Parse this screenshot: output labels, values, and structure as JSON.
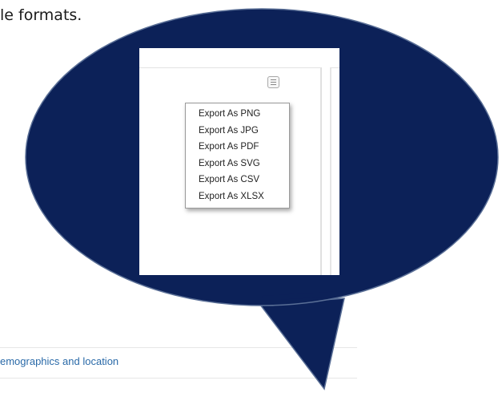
{
  "intro": {
    "text": "le formats."
  },
  "export_menu": {
    "button_icon": "hamburger-menu-icon",
    "items": [
      "Export As PNG",
      "Export As JPG",
      "Export As PDF",
      "Export As SVG",
      "Export As CSV",
      "Export As XLSX"
    ]
  },
  "tabs": {
    "demographics_link": "emographics and location"
  },
  "colors": {
    "bubble": "#0c2158",
    "link": "#2a6aa8"
  }
}
